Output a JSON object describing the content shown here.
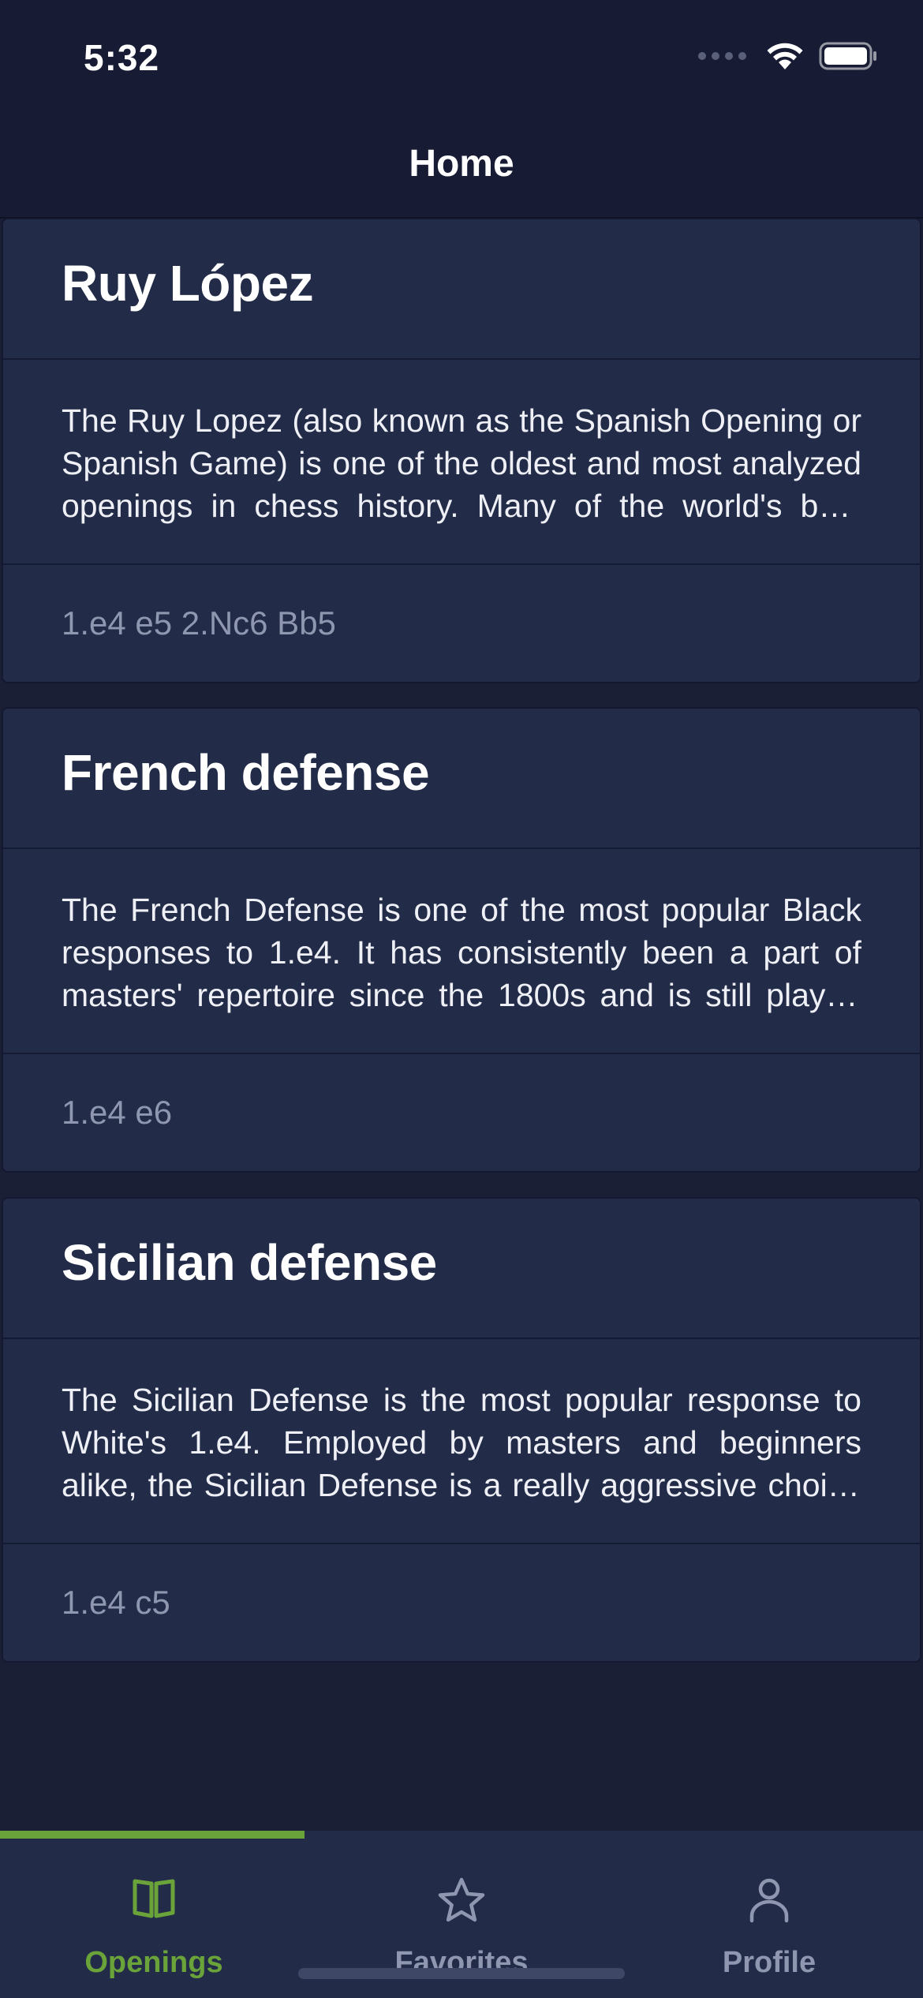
{
  "status_bar": {
    "time": "5:32"
  },
  "header": {
    "title": "Home"
  },
  "openings": [
    {
      "name": "Ruy López",
      "description": "The Ruy Lopez (also known as the Spanish Opening or Spanish Game) is one of the oldest and most analyzed openings in chess history. Many of the world's best players have used it.",
      "moves": "1.e4 e5 2.Nc6 Bb5"
    },
    {
      "name": "French defense",
      "description": "The French Defense is one of the most popular Black responses to 1.e4. It has consistently been a part of masters' repertoire since the 1800s and is still played today.",
      "moves": "1.e4 e6"
    },
    {
      "name": "Sicilian defense",
      "description": "The Sicilian Defense is the most popular response to White's 1.e4. Employed by masters and beginners alike, the Sicilian Defense is a really aggressive choice for Black.",
      "moves": "1.e4 c5"
    }
  ],
  "tab_bar": {
    "active_index": 0,
    "tabs": [
      {
        "label": "Openings",
        "icon": "book-icon"
      },
      {
        "label": "Favorites",
        "icon": "star-icon"
      },
      {
        "label": "Profile",
        "icon": "person-icon"
      }
    ]
  },
  "colors": {
    "background": "#1b1f36",
    "card": "#222b47",
    "accent": "#6aa33a",
    "inactive": "#8e96b0"
  }
}
